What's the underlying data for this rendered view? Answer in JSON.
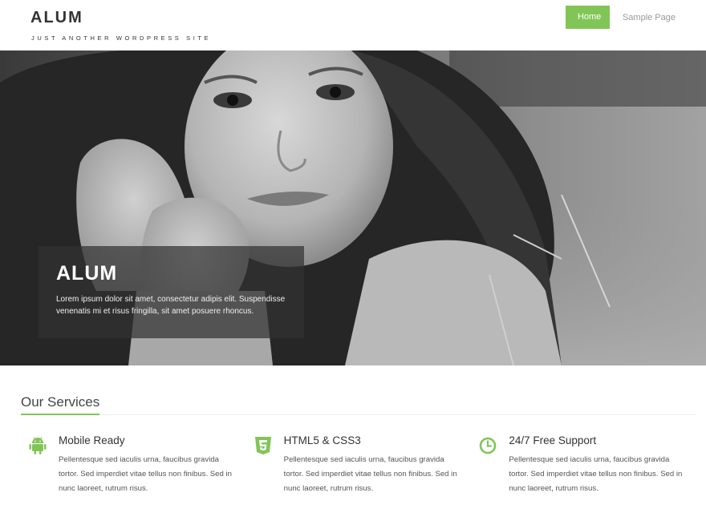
{
  "site": {
    "title": "ALUM",
    "tagline": "JUST ANOTHER WORDPRESS SITE"
  },
  "nav": {
    "items": [
      {
        "label": "Home",
        "active": true
      },
      {
        "label": "Sample Page",
        "active": false
      }
    ]
  },
  "hero": {
    "image": "black-and-white-photo-of-smiling-woman-lying-in-grass",
    "caption_title": "ALUM",
    "caption_text": "Lorem ipsum dolor sit amet, consectetur adipis elit. Suspendisse venenatis mi et risus fringilla, sit amet posuere rhoncus."
  },
  "services": {
    "heading": "Our Services",
    "items": [
      {
        "icon": "android-icon",
        "title": "Mobile Ready",
        "text": "Pellentesque sed iaculis urna, faucibus gravida tortor. Sed imperdiet vitae tellus non finibus. Sed in nunc laoreet, rutrum risus."
      },
      {
        "icon": "html5-icon",
        "title": "HTML5 & CSS3",
        "text": "Pellentesque sed iaculis urna, faucibus gravida tortor. Sed imperdiet vitae tellus non finibus. Sed in nunc laoreet, rutrum risus."
      },
      {
        "icon": "clock-icon",
        "title": "24/7 Free Support",
        "text": "Pellentesque sed iaculis urna, faucibus gravida tortor. Sed imperdiet vitae tellus non finibus. Sed in nunc laoreet, rutrum risus."
      }
    ]
  },
  "colors": {
    "accent": "#81c557",
    "caption_bg": "#323232",
    "text": "#444444"
  }
}
